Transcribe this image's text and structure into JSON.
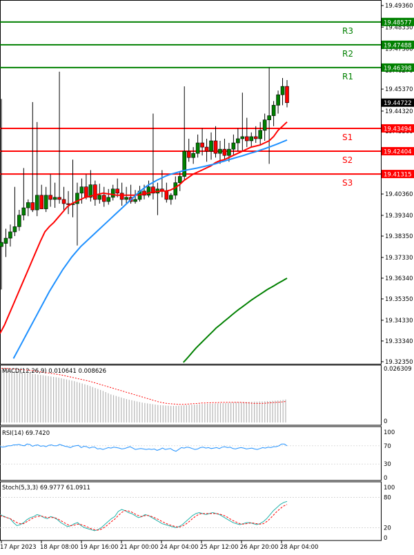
{
  "chart_data": {
    "type": "candlestick",
    "main": {
      "price_ticks": [
        "19.49360",
        "19.48330",
        "19.47300",
        "19.46270",
        "19.45370",
        "19.44320",
        "19.43360",
        "19.42370",
        "19.41330",
        "19.40360",
        "19.39340",
        "19.38350",
        "19.37330",
        "19.36340",
        "19.35350",
        "19.34330",
        "19.33340",
        "19.32350"
      ],
      "current_price": "19.44722",
      "levels": [
        {
          "name": "R3",
          "value": 19.48577,
          "label": "19.48577",
          "color": "#008000"
        },
        {
          "name": "R2",
          "value": 19.47488,
          "label": "19.47488",
          "color": "#008000"
        },
        {
          "name": "R1",
          "value": 19.46398,
          "label": "19.46398",
          "color": "#008000"
        },
        {
          "name": "S1",
          "value": 19.43494,
          "label": "19.43494",
          "color": "#ff0000"
        },
        {
          "name": "S2",
          "value": 19.42404,
          "label": "19.42404",
          "color": "#ff0000"
        },
        {
          "name": "S3",
          "value": 19.41315,
          "label": "19.41315",
          "color": "#ff0000"
        }
      ],
      "candles": [
        {
          "o": 19.3785,
          "h": 19.449,
          "l": 19.358,
          "c": 19.3805
        },
        {
          "o": 19.38,
          "h": 19.387,
          "l": 19.3735,
          "c": 19.3825
        },
        {
          "o": 19.3825,
          "h": 19.389,
          "l": 19.3785,
          "c": 19.3855
        },
        {
          "o": 19.3855,
          "h": 19.407,
          "l": 19.3835,
          "c": 19.388
        },
        {
          "o": 19.388,
          "h": 19.396,
          "l": 19.386,
          "c": 19.3935
        },
        {
          "o": 19.3935,
          "h": 19.416,
          "l": 19.391,
          "c": 19.397
        },
        {
          "o": 19.397,
          "h": 19.401,
          "l": 19.393,
          "c": 19.3995
        },
        {
          "o": 19.3995,
          "h": 19.4475,
          "l": 19.395,
          "c": 19.396
        },
        {
          "o": 19.396,
          "h": 19.438,
          "l": 19.393,
          "c": 19.403
        },
        {
          "o": 19.403,
          "h": 19.408,
          "l": 19.397,
          "c": 19.3965
        },
        {
          "o": 19.3965,
          "h": 19.407,
          "l": 19.395,
          "c": 19.403
        },
        {
          "o": 19.403,
          "h": 19.413,
          "l": 19.3975,
          "c": 19.401
        },
        {
          "o": 19.401,
          "h": 19.409,
          "l": 19.397,
          "c": 19.402
        },
        {
          "o": 19.402,
          "h": 19.462,
          "l": 19.399,
          "c": 19.401
        },
        {
          "o": 19.401,
          "h": 19.407,
          "l": 19.396,
          "c": 19.399
        },
        {
          "o": 19.399,
          "h": 19.405,
          "l": 19.394,
          "c": 19.3985
        },
        {
          "o": 19.3985,
          "h": 19.42,
          "l": 19.3925,
          "c": 19.399
        },
        {
          "o": 19.399,
          "h": 19.409,
          "l": 19.379,
          "c": 19.404
        },
        {
          "o": 19.404,
          "h": 19.411,
          "l": 19.399,
          "c": 19.407
        },
        {
          "o": 19.407,
          "h": 19.413,
          "l": 19.401,
          "c": 19.402
        },
        {
          "o": 19.402,
          "h": 19.415,
          "l": 19.4,
          "c": 19.408
        },
        {
          "o": 19.408,
          "h": 19.41,
          "l": 19.398,
          "c": 19.401
        },
        {
          "o": 19.401,
          "h": 19.4085,
          "l": 19.399,
          "c": 19.403
        },
        {
          "o": 19.403,
          "h": 19.407,
          "l": 19.3975,
          "c": 19.4
        },
        {
          "o": 19.4,
          "h": 19.406,
          "l": 19.3985,
          "c": 19.402
        },
        {
          "o": 19.402,
          "h": 19.408,
          "l": 19.4005,
          "c": 19.406
        },
        {
          "o": 19.406,
          "h": 19.411,
          "l": 19.402,
          "c": 19.404
        },
        {
          "o": 19.404,
          "h": 19.409,
          "l": 19.398,
          "c": 19.401
        },
        {
          "o": 19.401,
          "h": 19.407,
          "l": 19.399,
          "c": 19.402
        },
        {
          "o": 19.402,
          "h": 19.408,
          "l": 19.399,
          "c": 19.4
        },
        {
          "o": 19.4,
          "h": 19.4055,
          "l": 19.399,
          "c": 19.401
        },
        {
          "o": 19.401,
          "h": 19.4075,
          "l": 19.4,
          "c": 19.405
        },
        {
          "o": 19.405,
          "h": 19.408,
          "l": 19.401,
          "c": 19.403
        },
        {
          "o": 19.403,
          "h": 19.41,
          "l": 19.402,
          "c": 19.407
        },
        {
          "o": 19.407,
          "h": 19.442,
          "l": 19.401,
          "c": 19.404
        },
        {
          "o": 19.404,
          "h": 19.409,
          "l": 19.3935,
          "c": 19.406
        },
        {
          "o": 19.406,
          "h": 19.415,
          "l": 19.402,
          "c": 19.405
        },
        {
          "o": 19.405,
          "h": 19.409,
          "l": 19.3995,
          "c": 19.401
        },
        {
          "o": 19.401,
          "h": 19.404,
          "l": 19.3985,
          "c": 19.403
        },
        {
          "o": 19.403,
          "h": 19.412,
          "l": 19.401,
          "c": 19.409
        },
        {
          "o": 19.409,
          "h": 19.414,
          "l": 19.405,
          "c": 19.412
        },
        {
          "o": 19.412,
          "h": 19.455,
          "l": 19.41,
          "c": 19.424
        },
        {
          "o": 19.424,
          "h": 19.43,
          "l": 19.419,
          "c": 19.421
        },
        {
          "o": 19.421,
          "h": 19.426,
          "l": 19.418,
          "c": 19.423
        },
        {
          "o": 19.423,
          "h": 19.432,
          "l": 19.421,
          "c": 19.428
        },
        {
          "o": 19.428,
          "h": 19.435,
          "l": 19.422,
          "c": 19.426
        },
        {
          "o": 19.426,
          "h": 19.43,
          "l": 19.419,
          "c": 19.424
        },
        {
          "o": 19.424,
          "h": 19.433,
          "l": 19.42,
          "c": 19.429
        },
        {
          "o": 19.429,
          "h": 19.436,
          "l": 19.421,
          "c": 19.423
        },
        {
          "o": 19.423,
          "h": 19.429,
          "l": 19.418,
          "c": 19.425
        },
        {
          "o": 19.425,
          "h": 19.43,
          "l": 19.42,
          "c": 19.422
        },
        {
          "o": 19.422,
          "h": 19.428,
          "l": 19.419,
          "c": 19.425
        },
        {
          "o": 19.425,
          "h": 19.432,
          "l": 19.422,
          "c": 19.428
        },
        {
          "o": 19.428,
          "h": 19.435,
          "l": 19.424,
          "c": 19.43
        },
        {
          "o": 19.43,
          "h": 19.452,
          "l": 19.424,
          "c": 19.431
        },
        {
          "o": 19.431,
          "h": 19.44,
          "l": 19.426,
          "c": 19.429
        },
        {
          "o": 19.429,
          "h": 19.433,
          "l": 19.426,
          "c": 19.431
        },
        {
          "o": 19.431,
          "h": 19.436,
          "l": 19.428,
          "c": 19.43
        },
        {
          "o": 19.43,
          "h": 19.438,
          "l": 19.427,
          "c": 19.434
        },
        {
          "o": 19.434,
          "h": 19.442,
          "l": 19.429,
          "c": 19.439
        },
        {
          "o": 19.439,
          "h": 19.464,
          "l": 19.418,
          "c": 19.441
        },
        {
          "o": 19.441,
          "h": 19.448,
          "l": 19.436,
          "c": 19.446
        },
        {
          "o": 19.446,
          "h": 19.453,
          "l": 19.442,
          "c": 19.451
        },
        {
          "o": 19.451,
          "h": 19.459,
          "l": 19.446,
          "c": 19.455
        },
        {
          "o": 19.455,
          "h": 19.458,
          "l": 19.445,
          "c": 19.4472
        }
      ],
      "ma_red": [
        19.337,
        19.341,
        19.346,
        19.351,
        19.356,
        19.361,
        19.366,
        19.371,
        19.376,
        19.381,
        19.3855,
        19.388,
        19.39,
        19.3925,
        19.395,
        19.3975,
        19.399,
        19.4,
        19.401,
        19.402,
        19.4025,
        19.403,
        19.4035,
        19.404,
        19.4037,
        19.4034,
        19.403,
        19.403,
        19.403,
        19.403,
        19.403,
        19.4032,
        19.4035,
        19.404,
        19.4045,
        19.4048,
        19.405,
        19.405,
        19.4055,
        19.4065,
        19.408,
        19.41,
        19.4115,
        19.413,
        19.414,
        19.415,
        19.416,
        19.417,
        19.4185,
        19.4195,
        19.42,
        19.421,
        19.422,
        19.423,
        19.424,
        19.425,
        19.426,
        19.4265,
        19.427,
        19.428,
        19.429,
        19.431,
        19.434,
        19.436,
        19.438
      ],
      "ma_blue": [
        19.313,
        19.317,
        19.321,
        19.325,
        19.329,
        19.333,
        19.337,
        19.341,
        19.345,
        19.349,
        19.353,
        19.357,
        19.3605,
        19.364,
        19.3675,
        19.3705,
        19.3735,
        19.376,
        19.3785,
        19.3805,
        19.3825,
        19.3845,
        19.3865,
        19.3885,
        19.3905,
        19.3925,
        19.3945,
        19.3965,
        19.3985,
        19.4005,
        19.4025,
        19.4045,
        19.4062,
        19.4078,
        19.409,
        19.4102,
        19.4112,
        19.4122,
        19.413,
        19.4136,
        19.4142,
        19.4148,
        19.4152,
        19.4156,
        19.416,
        19.4165,
        19.417,
        19.4175,
        19.418,
        19.4187,
        19.4193,
        19.42,
        19.4206,
        19.4212,
        19.4218,
        19.4225,
        19.4232,
        19.4238,
        19.4245,
        19.4252,
        19.426,
        19.4268,
        19.4276,
        19.4285,
        19.4294
      ],
      "ma_green": [
        19.322,
        19.3232,
        19.3244,
        19.3258,
        19.3272,
        19.3286,
        19.33,
        19.3312,
        19.3324,
        19.3336,
        19.3348,
        19.336,
        19.3372,
        19.3384,
        19.3396,
        19.3406,
        19.3416,
        19.3426,
        19.3436,
        19.3446,
        19.3456,
        19.3466,
        19.3476,
        19.3485,
        19.3494,
        19.3503,
        19.3512,
        19.3521,
        19.353,
        19.3538,
        19.3546,
        19.3554,
        19.3562,
        19.357,
        19.3578,
        19.3585,
        19.3592,
        19.3599,
        19.3606,
        19.3613,
        19.362,
        19.3627,
        19.3634
      ]
    },
    "macd": {
      "label": "MACD(12,26,9) 0.010641 0.008626",
      "ticks": [
        "0.026309",
        "0"
      ],
      "ymin": 0,
      "ymax": 0.028,
      "hist": [
        0.027,
        0.027,
        0.0268,
        0.0266,
        0.0264,
        0.0263,
        0.0262,
        0.026,
        0.0258,
        0.0256,
        0.0254,
        0.0252,
        0.025,
        0.0248,
        0.0246,
        0.0244,
        0.0242,
        0.024,
        0.0238,
        0.0236,
        0.0234,
        0.0232,
        0.023,
        0.0227,
        0.0224,
        0.0221,
        0.0218,
        0.0215,
        0.0212,
        0.0208,
        0.0204,
        0.02,
        0.0196,
        0.0192,
        0.0187,
        0.0182,
        0.0177,
        0.0172,
        0.0167,
        0.0162,
        0.0156,
        0.015,
        0.0144,
        0.014,
        0.0136,
        0.0132,
        0.0128,
        0.0124,
        0.012,
        0.0117,
        0.0114,
        0.0111,
        0.0108,
        0.0105,
        0.0102,
        0.01,
        0.0098,
        0.0096,
        0.0094,
        0.0092,
        0.009,
        0.0089,
        0.0088,
        0.0087,
        0.0086,
        0.0085,
        0.0085,
        0.0085,
        0.0086,
        0.0087,
        0.0088,
        0.0089,
        0.009,
        0.0091,
        0.0092,
        0.0093,
        0.0094,
        0.0095,
        0.0096,
        0.0096,
        0.0097,
        0.0097,
        0.0098,
        0.0098,
        0.0099,
        0.0099,
        0.01,
        0.0101,
        0.0102,
        0.0103,
        0.0104,
        0.0104,
        0.0104,
        0.0105,
        0.0105,
        0.0106,
        0.0106,
        0.0107,
        0.0107,
        0.0108,
        0.0108,
        0.0109,
        0.011,
        0.011,
        0.0111,
        0.0112,
        0.0113,
        0.0114,
        0.0116,
        0.0118
      ],
      "signal": [
        0.0278,
        0.0278,
        0.0277,
        0.0276,
        0.0275,
        0.0274,
        0.0273,
        0.0272,
        0.0271,
        0.027,
        0.0269,
        0.0268,
        0.0266,
        0.0264,
        0.0262,
        0.026,
        0.0258,
        0.0256,
        0.0254,
        0.0252,
        0.025,
        0.0248,
        0.0246,
        0.0244,
        0.0241,
        0.0238,
        0.0235,
        0.0232,
        0.0229,
        0.0226,
        0.0223,
        0.022,
        0.0217,
        0.0214,
        0.0211,
        0.0207,
        0.0203,
        0.0199,
        0.0195,
        0.0191,
        0.0187,
        0.0183,
        0.0179,
        0.0175,
        0.0171,
        0.0167,
        0.0163,
        0.0159,
        0.0155,
        0.0151,
        0.0147,
        0.0143,
        0.0139,
        0.0135,
        0.0131,
        0.0127,
        0.0123,
        0.0119,
        0.0115,
        0.0111,
        0.0107,
        0.0104,
        0.0101,
        0.0099,
        0.0097,
        0.0096,
        0.0095,
        0.0094,
        0.0093,
        0.0093,
        0.0093,
        0.0094,
        0.0095,
        0.0096,
        0.0097,
        0.0098,
        0.0099,
        0.01,
        0.01,
        0.0101,
        0.0101,
        0.0102,
        0.0102,
        0.0102,
        0.0103,
        0.0103,
        0.0103,
        0.0104,
        0.0104,
        0.0104,
        0.0104,
        0.0104,
        0.0103,
        0.0102,
        0.0101,
        0.01,
        0.0099,
        0.0098,
        0.0098,
        0.0098,
        0.0098,
        0.0099,
        0.01,
        0.0101,
        0.0102,
        0.0103,
        0.0104,
        0.0105,
        0.0106,
        0.0108
      ]
    },
    "rsi": {
      "label": "RSI(14) 69.7420",
      "ticks": [
        "100",
        "70",
        "30",
        "0"
      ],
      "values": [
        68,
        67,
        68,
        70,
        70,
        72,
        72,
        73,
        71,
        70,
        74,
        73,
        69,
        71,
        72,
        69,
        70,
        68,
        71,
        72,
        70,
        70,
        73,
        71,
        69,
        68,
        66,
        69,
        70,
        71,
        66,
        69,
        68,
        65,
        67,
        67,
        63,
        64,
        62,
        64,
        66,
        65,
        67,
        66,
        65,
        63,
        64,
        66,
        68,
        65,
        62,
        63,
        64,
        63,
        62,
        63,
        62,
        63,
        60,
        62,
        65,
        62,
        63,
        64,
        60,
        58,
        62,
        66,
        65,
        67,
        66,
        64,
        62,
        63,
        66,
        67,
        65,
        66,
        64,
        65,
        66,
        64,
        67,
        68,
        66,
        67,
        64,
        63,
        65,
        66,
        65,
        63,
        64,
        65,
        63,
        62,
        64,
        66,
        65,
        67,
        66,
        68,
        68,
        70,
        74,
        74,
        70
      ]
    },
    "stoch": {
      "label": "Stoch(5,3,3) 69.9777 61.0911",
      "ticks": [
        "100",
        "80",
        "20",
        "0"
      ],
      "k": [
        46,
        43,
        40,
        38,
        30,
        24,
        26,
        30,
        36,
        40,
        42,
        46,
        44,
        40,
        38,
        42,
        40,
        36,
        30,
        26,
        22,
        24,
        28,
        30,
        24,
        20,
        18,
        16,
        14,
        16,
        20,
        26,
        32,
        38,
        42,
        52,
        56,
        54,
        50,
        48,
        44,
        40,
        42,
        46,
        44,
        40,
        36,
        32,
        28,
        26,
        24,
        22,
        20,
        22,
        26,
        32,
        38,
        44,
        48,
        50,
        48,
        46,
        48,
        50,
        48,
        46,
        42,
        38,
        34,
        30,
        28,
        26,
        28,
        30,
        30,
        28,
        26,
        28,
        32,
        38,
        46,
        54,
        60,
        66,
        70,
        72
      ],
      "d": [
        44,
        42,
        40,
        38,
        34,
        30,
        28,
        28,
        32,
        36,
        40,
        42,
        43,
        42,
        40,
        40,
        40,
        38,
        34,
        30,
        26,
        24,
        25,
        27,
        26,
        24,
        21,
        18,
        16,
        15,
        17,
        21,
        26,
        32,
        37,
        44,
        50,
        54,
        53,
        51,
        47,
        44,
        42,
        44,
        44,
        42,
        39,
        36,
        32,
        29,
        26,
        24,
        22,
        21,
        23,
        27,
        32,
        38,
        43,
        47,
        48,
        48,
        48,
        48,
        48,
        47,
        45,
        42,
        38,
        34,
        31,
        28,
        27,
        28,
        29,
        29,
        28,
        27,
        28,
        32,
        38,
        45,
        52,
        58,
        63,
        66
      ]
    },
    "x_tick_labels": [
      "17 Apr 2023",
      "18 Apr 08:00",
      "19 Apr 16:00",
      "21 Apr 00:00",
      "24 Apr 04:00",
      "25 Apr 12:00",
      "26 Apr 20:00",
      "28 Apr 04:00"
    ],
    "colors": {
      "bull": "#008000",
      "bear": "#ff0000",
      "ma_red": "#ff0000",
      "ma_blue": "#1e90ff",
      "ma_green": "#008000",
      "support": "#ff0000",
      "resistance": "#008000"
    }
  }
}
